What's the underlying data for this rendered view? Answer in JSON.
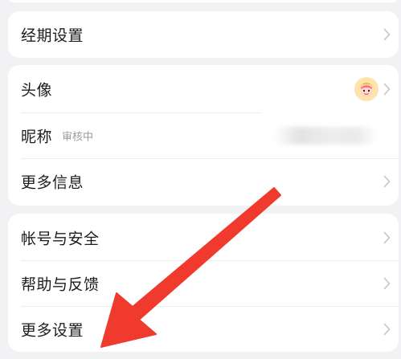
{
  "top_card": {
    "items": [
      {
        "label": "经期设置"
      }
    ]
  },
  "profile_card": {
    "avatar_label": "头像",
    "nickname_label": "昵称",
    "nickname_status": "审核中",
    "more_info_label": "更多信息"
  },
  "account_card": {
    "items": [
      {
        "label": "帐号与安全"
      },
      {
        "label": "帮助与反馈"
      },
      {
        "label": "更多设置"
      }
    ]
  },
  "annotation": {
    "color": "#f03a2e",
    "icon": "red-arrow"
  },
  "icons": {
    "chevron": "chevron-right-icon",
    "avatar": "avatar-image"
  }
}
